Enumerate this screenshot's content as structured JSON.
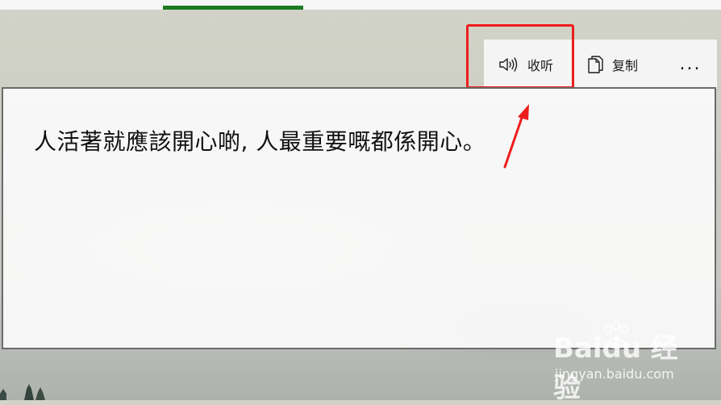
{
  "tabs": {
    "active_indicator_color": "#1b7a22"
  },
  "toolbar": {
    "listen_label": "收听",
    "listen_icon": "speaker-icon",
    "copy_label": "复制",
    "copy_icon": "copy-icon",
    "more_label": "..."
  },
  "result": {
    "text": "人活著就應該開心啲, 人最重要嘅都係開心。"
  },
  "annotation": {
    "highlight_color": "#ee1d1d"
  },
  "watermark": {
    "logo_text": "Baidu 经验",
    "url": "jingyan.baidu.com"
  }
}
